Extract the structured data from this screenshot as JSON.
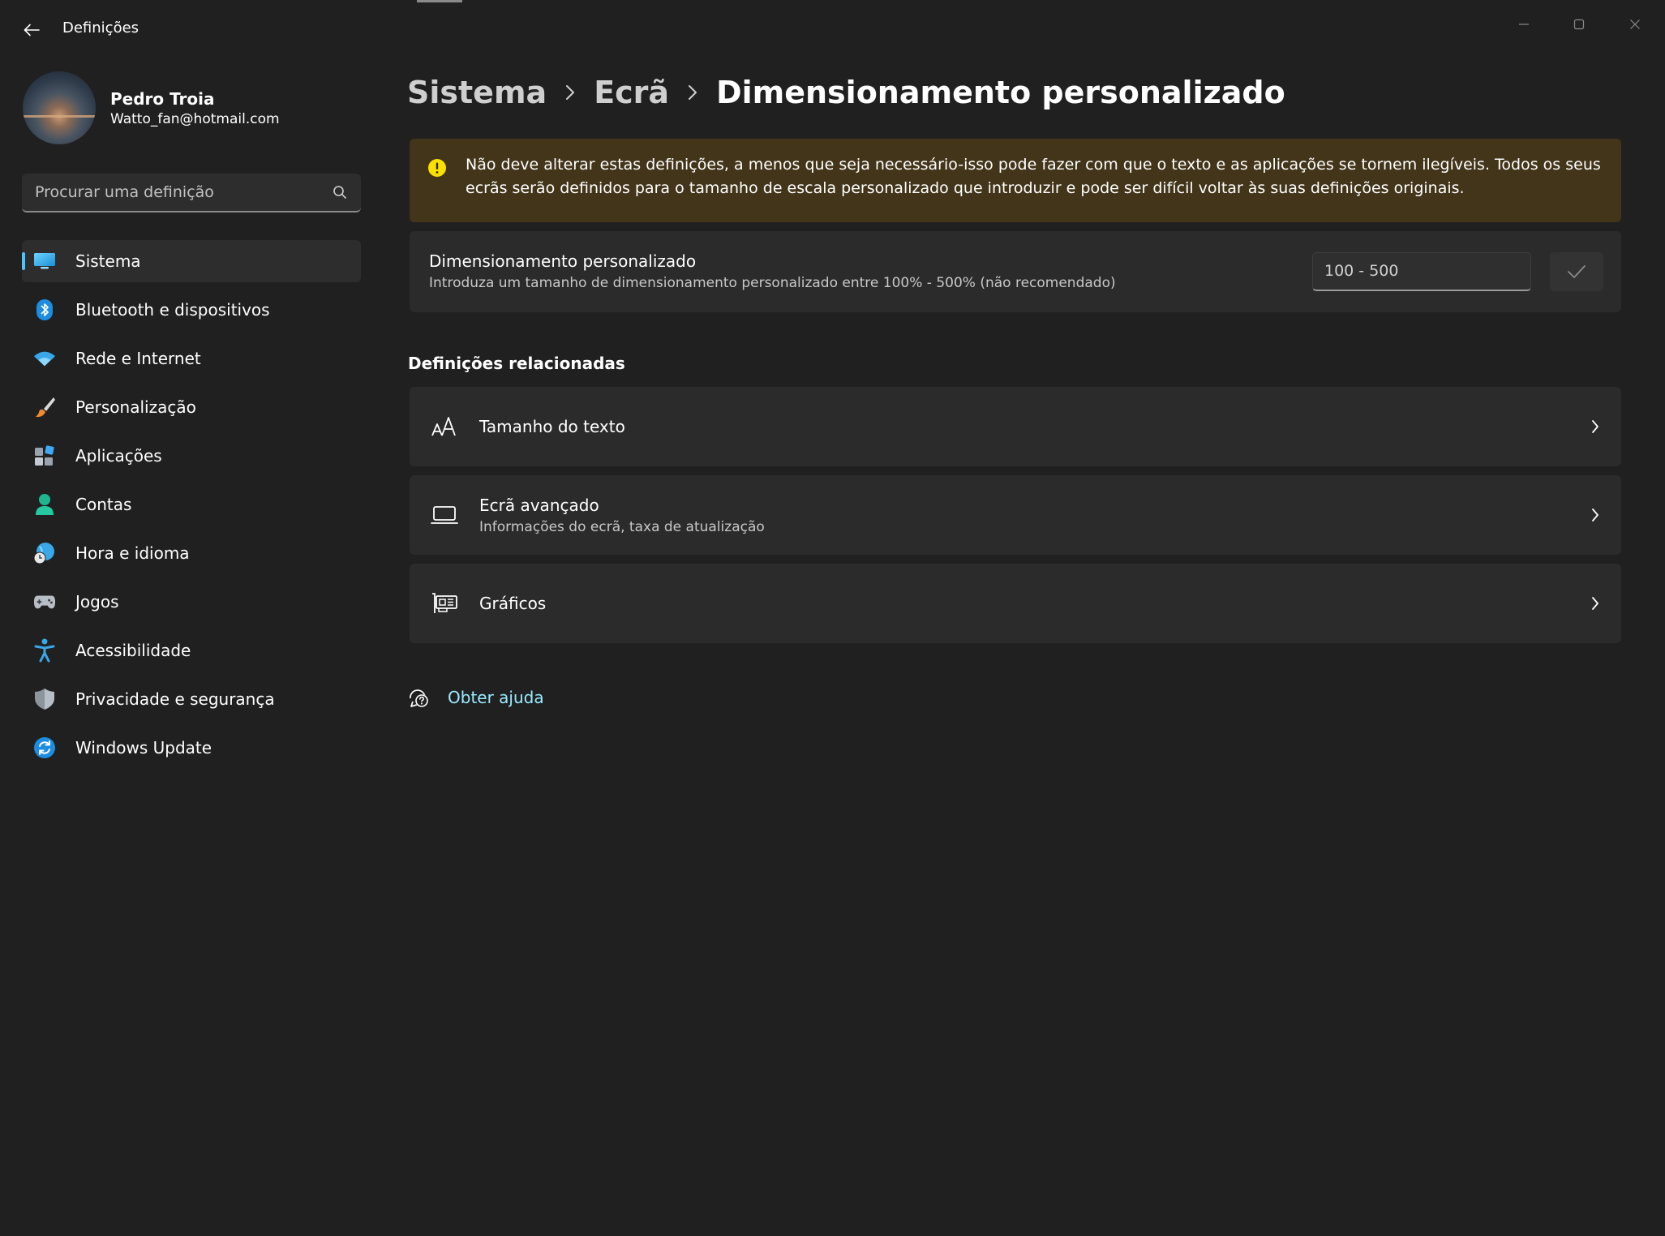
{
  "window": {
    "title": "Definições",
    "back_label": "Voltar"
  },
  "user": {
    "name": "Pedro Troia",
    "email": "Watto_fan@hotmail.com"
  },
  "search": {
    "placeholder": "Procurar uma definição"
  },
  "sidebar": {
    "items": [
      {
        "label": "Sistema",
        "icon": "monitor-icon",
        "active": true
      },
      {
        "label": "Bluetooth e dispositivos",
        "icon": "bluetooth-icon"
      },
      {
        "label": "Rede e Internet",
        "icon": "wifi-icon"
      },
      {
        "label": "Personalização",
        "icon": "brush-icon"
      },
      {
        "label": "Aplicações",
        "icon": "apps-icon"
      },
      {
        "label": "Contas",
        "icon": "person-icon"
      },
      {
        "label": "Hora e idioma",
        "icon": "globe-clock-icon"
      },
      {
        "label": "Jogos",
        "icon": "gamepad-icon"
      },
      {
        "label": "Acessibilidade",
        "icon": "accessibility-icon"
      },
      {
        "label": "Privacidade e segurança",
        "icon": "shield-icon"
      },
      {
        "label": "Windows Update",
        "icon": "update-icon"
      }
    ]
  },
  "breadcrumb": {
    "items": [
      "Sistema",
      "Ecrã",
      "Dimensionamento personalizado"
    ]
  },
  "warning": {
    "text": "Não deve alterar estas definições, a menos que seja necessário-isso pode fazer com que o texto e as aplicações se tornem ilegíveis. Todos os seus ecrãs serão definidos para o tamanho de escala personalizado que introduzir e pode ser difícil voltar às suas definições originais."
  },
  "custom_scaling": {
    "title": "Dimensionamento personalizado",
    "description": "Introduza um tamanho de dimensionamento personalizado entre 100% - 500% (não recomendado)",
    "input_placeholder": "100 - 500"
  },
  "related": {
    "title": "Definições relacionadas",
    "items": [
      {
        "title": "Tamanho do texto",
        "subtitle": "",
        "icon": "text-size-icon"
      },
      {
        "title": "Ecrã avançado",
        "subtitle": "Informações do ecrã, taxa de atualização",
        "icon": "laptop-icon"
      },
      {
        "title": "Gráficos",
        "subtitle": "",
        "icon": "graphics-card-icon"
      }
    ]
  },
  "help": {
    "label": "Obter ajuda"
  },
  "colors": {
    "background": "#202020",
    "card": "#2b2b2b",
    "accent": "#4cc2ff",
    "warning_bg": "#433519",
    "warning_icon": "#fce100",
    "link": "#99ebff"
  }
}
